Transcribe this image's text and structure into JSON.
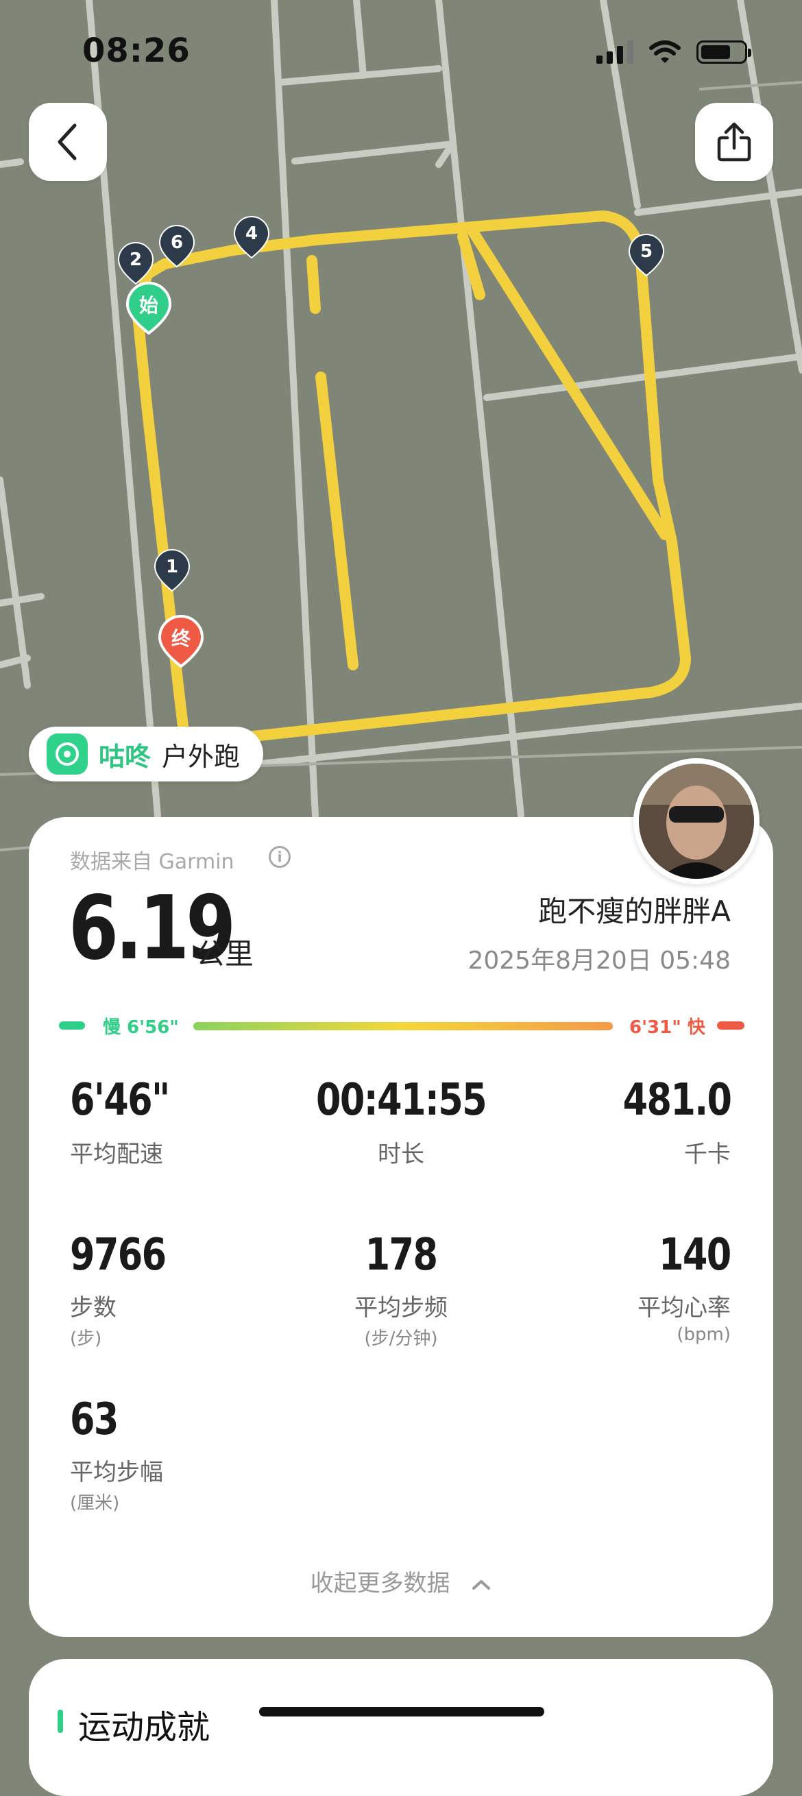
{
  "status_bar": {
    "time": "08:26"
  },
  "map": {
    "markers": [
      "1",
      "2",
      "4",
      "5",
      "6"
    ],
    "start_label": "始",
    "end_label": "终",
    "route_color": "#f3d03e"
  },
  "app_chip": {
    "brand": "咕咚",
    "sport": "户外跑"
  },
  "summary": {
    "source": "数据来自 Garmin",
    "info_icon": "i",
    "distance": "6.19",
    "distance_unit": "公里",
    "user_name": "跑不瘦的胖胖A",
    "date": "2025年8月20日 05:48"
  },
  "pace_bar": {
    "slow": "慢 6'56\"",
    "fast": "6'31\" 快"
  },
  "stats": [
    {
      "value": "6'46\"",
      "label": "平均配速"
    },
    {
      "value": "00:41:55",
      "label": "时长"
    },
    {
      "value": "481.0",
      "label": "千卡"
    },
    {
      "value": "9766",
      "label": "步数",
      "unit": "(步)"
    },
    {
      "value": "178",
      "label": "平均步频",
      "unit": "(步/分钟)"
    },
    {
      "value": "140",
      "label": "平均心率",
      "unit": "(bpm)"
    },
    {
      "value": "63",
      "label": "平均步幅",
      "unit": "(厘米)"
    }
  ],
  "collapse_label": "收起更多数据",
  "achievements": {
    "title": "运动成就"
  },
  "colors": {
    "brand_green": "#2fc684",
    "slow": "#2fcf8a",
    "fast": "#ef5a44"
  }
}
